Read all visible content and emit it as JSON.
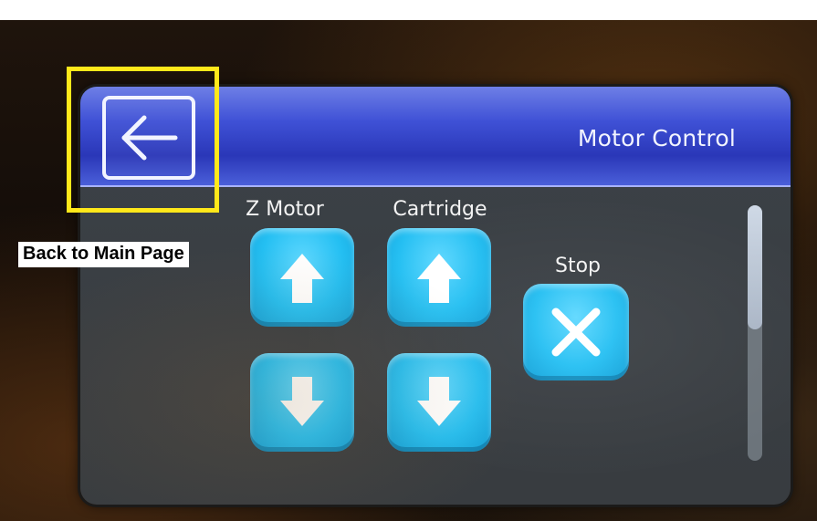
{
  "screen": {
    "title": "Motor Control",
    "back_icon": "arrow-left-icon"
  },
  "controls": {
    "z_motor": {
      "label": "Z Motor",
      "up_icon": "arrow-up-icon",
      "down_icon": "arrow-down-icon"
    },
    "cartridge": {
      "label": "Cartridge",
      "up_icon": "arrow-up-icon",
      "down_icon": "arrow-down-icon"
    },
    "stop": {
      "label": "Stop",
      "icon": "close-icon"
    }
  },
  "annotation": {
    "caption": "Back to Main Page",
    "highlight_color": "#ffe81a"
  },
  "colors": {
    "title_bar": "#3f51d6",
    "button": "#24bff2",
    "panel": "#3a3f44"
  },
  "scrollbar": {
    "position_fraction": 0.0
  }
}
